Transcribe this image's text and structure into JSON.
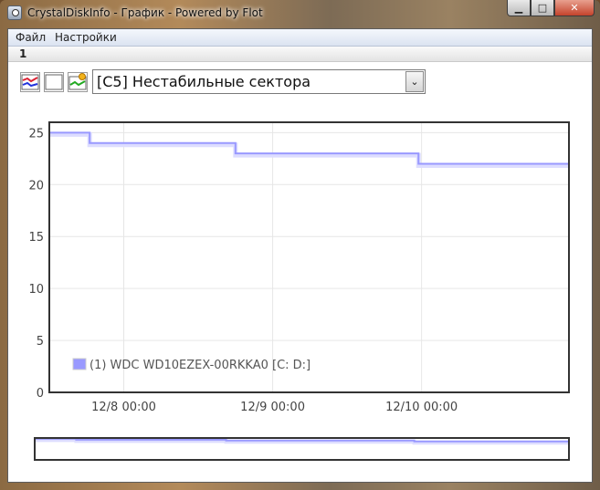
{
  "window": {
    "title": "CrystalDiskInfo - График - Powered by Flot",
    "buttons": {
      "minimize": "▁",
      "maximize": "□",
      "close": "✕"
    }
  },
  "menu": [
    "Файл",
    "Настройки"
  ],
  "tabs": [
    "1"
  ],
  "toolbar": {
    "icons": [
      "chart-icon",
      "blank-icon",
      "chart-refresh-icon"
    ],
    "attribute_select": {
      "value": "[C5] Нестабильные сектора",
      "arrow": "⌄"
    }
  },
  "chart_data": {
    "type": "line",
    "title": "",
    "xlabel": "",
    "ylabel": "",
    "ylim": [
      0,
      26
    ],
    "yticks": [
      "0",
      "5",
      "10",
      "15",
      "20",
      "25"
    ],
    "xticks": [
      "12/8 00:00",
      "12/9 00:00",
      "12/10 00:00"
    ],
    "grid": true,
    "legend_position": "bottom-left",
    "series": [
      {
        "name": "(1) WDC WD10EZEX-00RKKA0 [C: D:]",
        "color": "#9999ff",
        "step": true,
        "x": [
          "12/7 12:30",
          "12/7 18:30",
          "12/8 18:00",
          "12/9 23:30",
          "12/10 23:00"
        ],
        "values": [
          25,
          24,
          23,
          22,
          22
        ]
      }
    ],
    "overview": {
      "grid": false
    }
  }
}
